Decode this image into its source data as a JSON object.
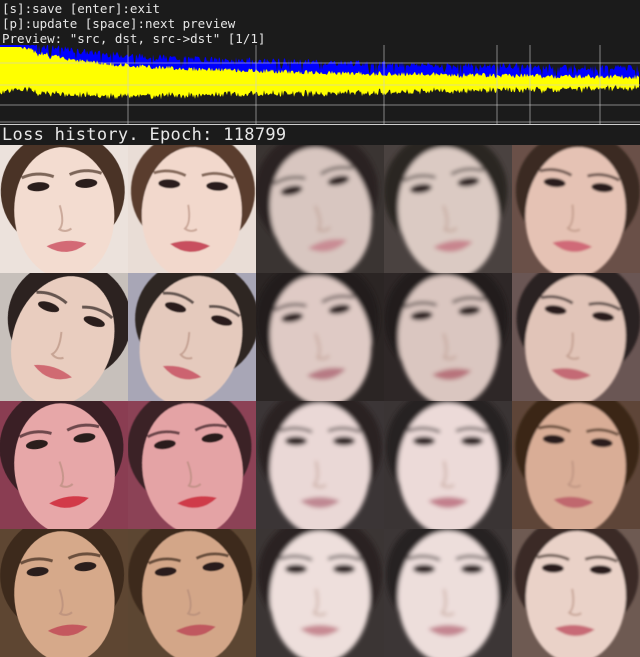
{
  "help": {
    "line1": "[s]:save [enter]:exit",
    "line2": "[p]:update [space]:next preview",
    "line3": "Preview: \"src, dst, src->dst\" [1/1]"
  },
  "loss_title": "Loss history. Epoch: 118799",
  "chart_data": {
    "type": "area",
    "title": "Loss history. Epoch: 118799",
    "series": [
      {
        "color": "#0000ff",
        "values": [
          0.95,
          0.75,
          0.66,
          0.6,
          0.56,
          0.53,
          0.51,
          0.49,
          0.47,
          0.46,
          0.45,
          0.44,
          0.43,
          0.42,
          0.41,
          0.4,
          0.39,
          0.38,
          0.375,
          0.37,
          0.365,
          0.36,
          0.355,
          0.35,
          0.345
        ]
      },
      {
        "color": "#ffff00",
        "values": [
          0.98,
          0.82,
          0.73,
          0.67,
          0.63,
          0.6,
          0.58,
          0.56,
          0.55,
          0.54,
          0.53,
          0.52,
          0.51,
          0.5,
          0.5,
          0.49,
          0.49,
          0.48,
          0.48,
          0.47,
          0.47,
          0.46,
          0.46,
          0.46,
          0.45
        ]
      }
    ],
    "grid": true
  },
  "colors": {
    "background": "#1b1b1b",
    "src_loss": "#ffff00",
    "dst_loss": "#0000ff",
    "gridline": "#cfcfcf"
  },
  "preview": {
    "columns": [
      "src",
      "src",
      "dst",
      "dst",
      "src->dst"
    ],
    "rows": 4
  }
}
